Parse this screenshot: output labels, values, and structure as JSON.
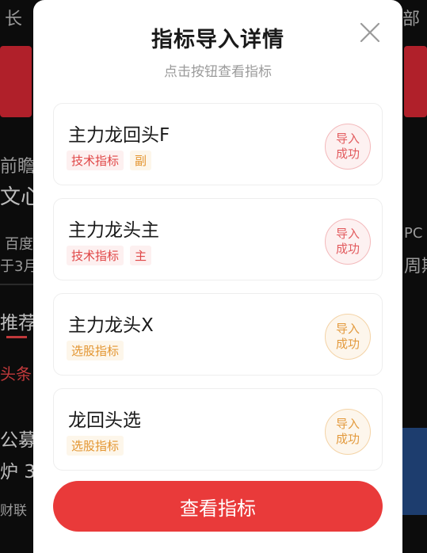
{
  "background": {
    "texts": [
      "长",
      "部",
      "前瞻",
      "文心",
      "百度",
      "PC",
      "于3月",
      "周期",
      "推荐",
      "头条",
      "公募",
      "炉 3",
      "财联"
    ]
  },
  "modal": {
    "title": "指标导入详情",
    "subtitle": "点击按钮查看指标",
    "items": [
      {
        "name": "主力龙回头F",
        "tags": [
          "技术指标",
          "副"
        ],
        "status": [
          "导入",
          "成功"
        ]
      },
      {
        "name": "主力龙头主",
        "tags": [
          "技术指标",
          "主"
        ],
        "status": [
          "导入",
          "成功"
        ]
      },
      {
        "name": "主力龙头X",
        "tags": [
          "选股指标"
        ],
        "status": [
          "导入",
          "成功"
        ]
      },
      {
        "name": "龙回头选",
        "tags": [
          "选股指标"
        ],
        "status": [
          "导入",
          "成功"
        ]
      }
    ],
    "button_label": "查看指标"
  },
  "colors": {
    "accent": "#e93a3a",
    "tag_red": "#e04646",
    "tag_orange": "#e39530"
  }
}
